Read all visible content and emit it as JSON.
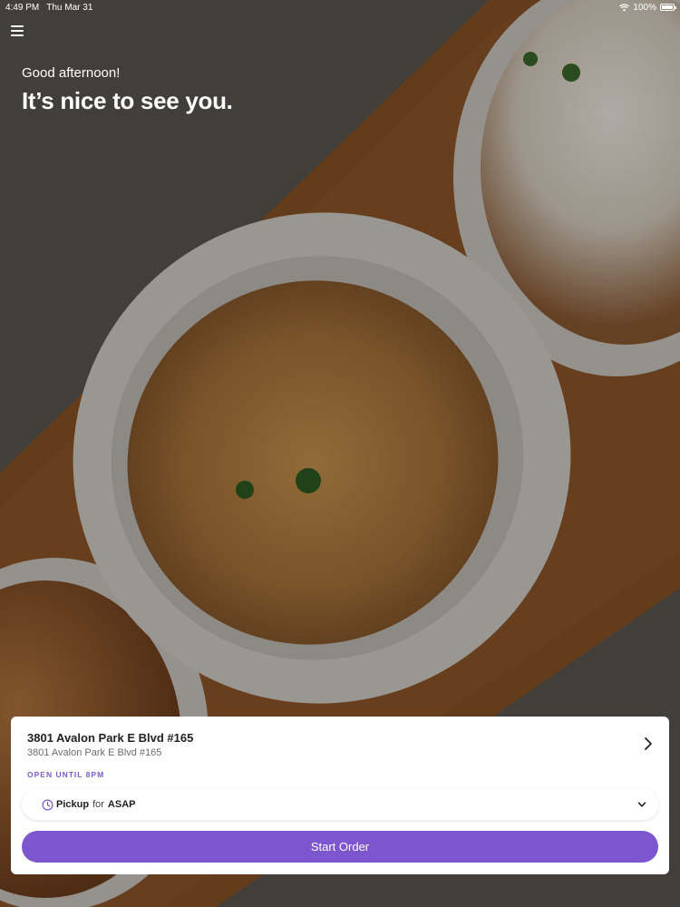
{
  "status_bar": {
    "time": "4:49 PM",
    "date": "Thu Mar 31",
    "battery": "100%"
  },
  "hero": {
    "greeting": "Good afternoon!",
    "headline": "It’s nice to see you."
  },
  "location": {
    "name": "3801 Avalon Park E Blvd #165",
    "address": "3801 Avalon Park E Blvd #165",
    "status": "OPEN UNTIL 8PM"
  },
  "order": {
    "mode": "Pickup",
    "for_label": "for",
    "time": "ASAP",
    "start_label": "Start Order"
  },
  "colors": {
    "accent": "#7d55cf",
    "status": "#7a5cc8"
  },
  "icons": [
    "menu-icon",
    "wifi-icon",
    "battery-icon",
    "chevron-right-icon",
    "clock-icon",
    "chevron-down-icon"
  ]
}
